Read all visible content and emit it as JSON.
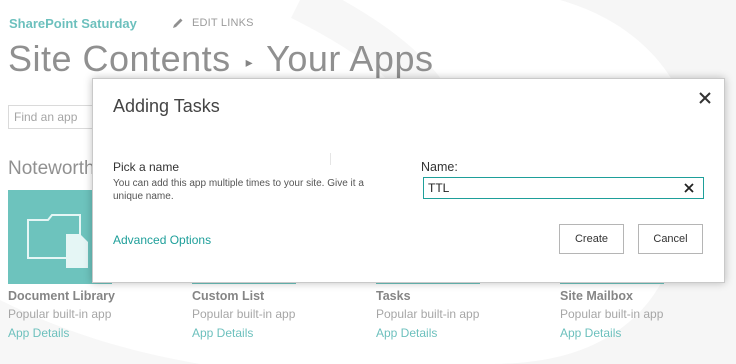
{
  "header": {
    "site_title": "SharePoint Saturday",
    "edit_links": "EDIT LINKS",
    "title_part1": "Site Contents",
    "title_separator": "▸",
    "title_part2": "Your Apps"
  },
  "search": {
    "placeholder": "Find an app"
  },
  "section": {
    "noteworthy": "Noteworthy"
  },
  "apps": [
    {
      "name": "Document Library",
      "desc": "Popular built-in app",
      "link": "App Details"
    },
    {
      "name": "Custom List",
      "desc": "Popular built-in app",
      "link": "App Details"
    },
    {
      "name": "Tasks",
      "desc": "Popular built-in app",
      "link": "App Details"
    },
    {
      "name": "Site Mailbox",
      "desc": "Popular built-in app",
      "link": "App Details"
    }
  ],
  "dialog": {
    "title": "Adding Tasks",
    "pick_heading": "Pick a name",
    "pick_help": "You can add this app multiple times to your site. Give it a unique name.",
    "name_label": "Name:",
    "name_value": "TTL",
    "advanced": "Advanced Options",
    "create": "Create",
    "cancel": "Cancel"
  },
  "colors": {
    "accent": "#1e9f9a",
    "tile": "#20a39a"
  },
  "icons": {
    "edit": "pencil-icon",
    "close": "close-icon",
    "clear": "clear-icon",
    "tile": "document-library-icon"
  }
}
